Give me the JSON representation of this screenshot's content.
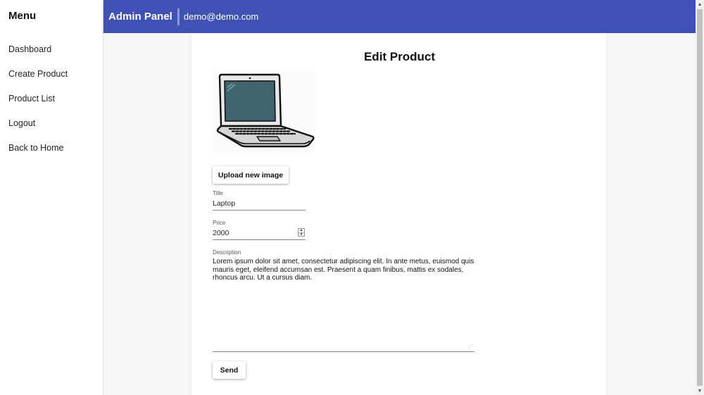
{
  "sidebar": {
    "title": "Menu",
    "items": [
      {
        "label": "Dashboard"
      },
      {
        "label": "Create Product"
      },
      {
        "label": "Product List"
      },
      {
        "label": "Logout"
      },
      {
        "label": "Back to Home"
      }
    ]
  },
  "header": {
    "title": "Admin Panel",
    "email": "demo@demo.com",
    "background": "#3f51b5"
  },
  "form": {
    "page_title": "Edit Product",
    "image_icon": "laptop-image",
    "upload_label": "Upload new image",
    "title_label": "Title",
    "title_value": "Laptop",
    "price_label": "Price",
    "price_value": "2000",
    "description_label": "Description",
    "description_value": "Lorem ipsum dolor sit amet, consectetur adipiscing elit. In ante metus, euismod quis mauris eget, eleifend accumsan est. Praesent a quam finibus, mattis ex sodales, rhoncus arcu. Ut a cursus diam.",
    "send_label": "Send"
  }
}
